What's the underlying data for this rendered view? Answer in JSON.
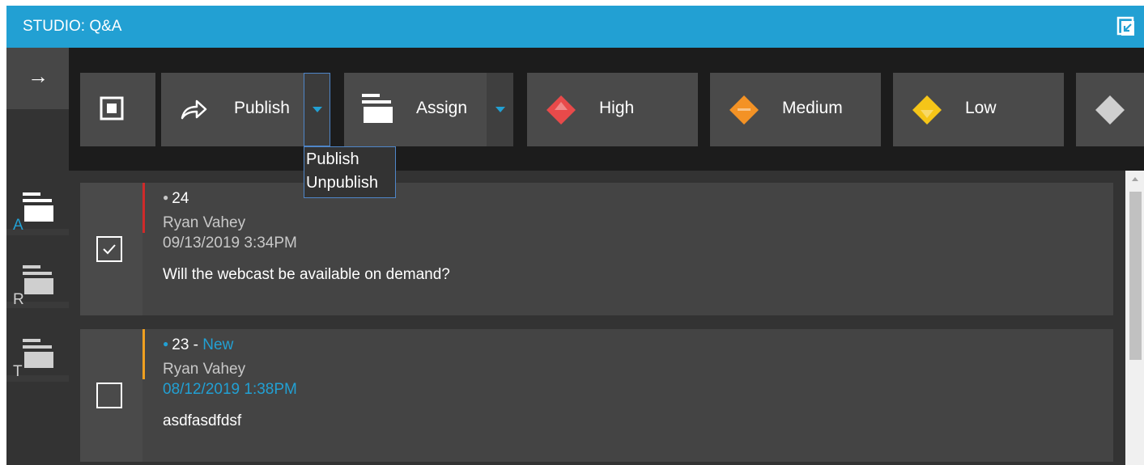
{
  "window": {
    "title": "STUDIO: Q&A",
    "popout_icon": "popout-icon"
  },
  "nav": {
    "arrow": "→",
    "folders": [
      {
        "letter": "A",
        "letter_color": "#22a0d3",
        "icon": "folder-icon",
        "icon_color": "#ffffff"
      },
      {
        "letter": "R",
        "letter_color": "#cfcfcf",
        "icon": "folder-icon",
        "icon_color": "#cfcfcf"
      },
      {
        "letter": "T",
        "letter_color": "#cfcfcf",
        "icon": "folder-icon",
        "icon_color": "#cfcfcf"
      }
    ]
  },
  "toolbar": {
    "select_all_icon": "select-all-icon",
    "publish_label": "Publish",
    "assign_label": "Assign",
    "high_label": "High",
    "medium_label": "Medium",
    "low_label": "Low",
    "priority_colors": {
      "high": "#e84a4a",
      "medium": "#f39225",
      "low": "#f5c518",
      "none": "#cfcfcf"
    }
  },
  "publish_menu": {
    "items": [
      "Publish",
      "Unpublish"
    ]
  },
  "questions": [
    {
      "id_line": "24",
      "is_new": false,
      "new_label": "",
      "author": "Ryan Vahey",
      "timestamp": "09/13/2019 3:34PM",
      "text": "Will the webcast be available on demand?",
      "checked": true,
      "stripe_color": "#cf2a2a"
    },
    {
      "id_line": "23 - ",
      "is_new": true,
      "new_label": "New",
      "author": "Ryan Vahey",
      "timestamp": "08/12/2019 1:38PM",
      "text": "asdfasdfdsf",
      "checked": false,
      "stripe_color": "#f0a020"
    }
  ],
  "colors": {
    "accent": "#22a0d3"
  }
}
